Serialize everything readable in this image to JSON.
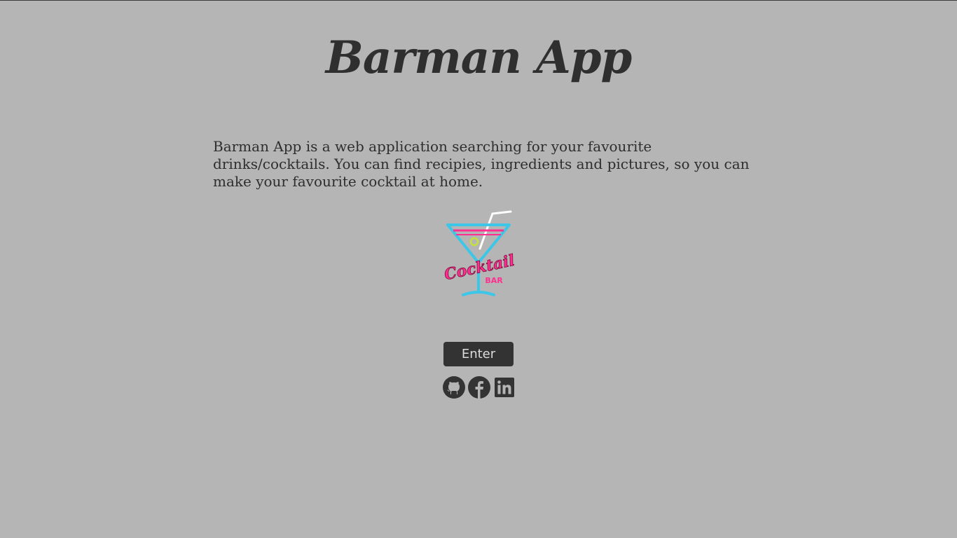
{
  "header": {
    "title": "Barman App"
  },
  "main": {
    "description": "Barman App is a web application searching for your favourite drinks/cocktails. You can find recipies, ingredients and pictures, so you can make your favourite cocktail at home.",
    "logo": {
      "icon": "cocktail-bar-neon-logo",
      "text_main": "Cocktail",
      "text_sub": "BAR"
    },
    "enter_label": "Enter"
  },
  "social": {
    "items": [
      {
        "icon": "github-icon"
      },
      {
        "icon": "facebook-icon"
      },
      {
        "icon": "linkedin-icon"
      }
    ]
  },
  "colors": {
    "background": "#b5b5b5",
    "text": "#2e2e2e",
    "button_bg": "#333333",
    "button_text": "#dcdcdc",
    "neon_cyan": "#3cc6e8",
    "neon_pink": "#ff2f8f"
  }
}
